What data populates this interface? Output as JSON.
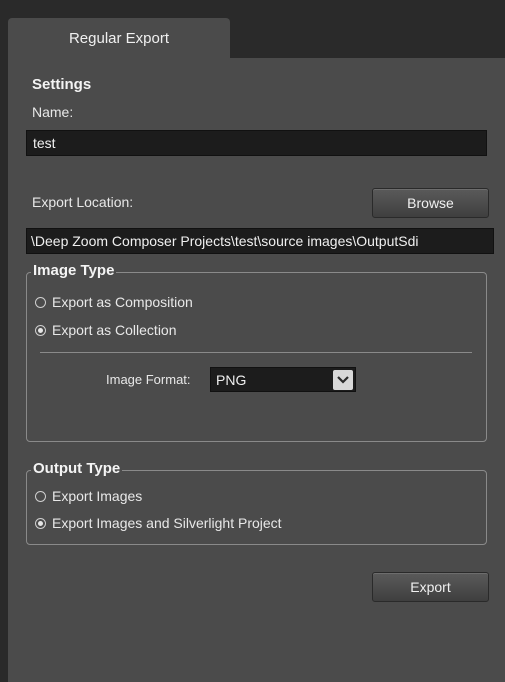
{
  "tabs": [
    {
      "label": "Regular Export"
    }
  ],
  "settings": {
    "heading": "Settings",
    "name_label": "Name:",
    "name_value": "test"
  },
  "export_location": {
    "label": "Export Location:",
    "browse_label": "Browse",
    "path_value": "\\Deep Zoom Composer Projects\\test\\source images\\OutputSdi"
  },
  "image_type": {
    "legend": "Image Type",
    "options": [
      {
        "label": "Export as Composition",
        "checked": false
      },
      {
        "label": "Export as Collection",
        "checked": true
      }
    ],
    "format_label": "Image Format:",
    "format_value": "PNG"
  },
  "output_type": {
    "legend": "Output Type",
    "options": [
      {
        "label": "Export Images",
        "checked": false
      },
      {
        "label": "Export Images and Silverlight Project",
        "checked": true
      }
    ]
  },
  "export_button": {
    "label": "Export"
  },
  "icons": {
    "dropdown": "chevron-down-icon"
  }
}
